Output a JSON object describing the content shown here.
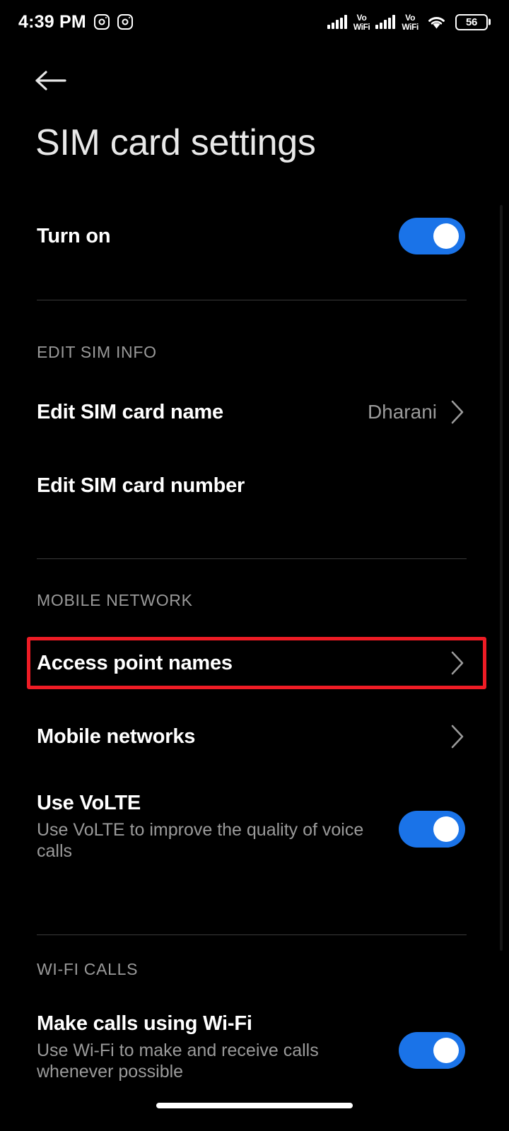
{
  "status_bar": {
    "time": "4:39 PM",
    "notification_icons": [
      "instagram-icon",
      "instagram-icon"
    ],
    "signal_1": {
      "icon": "signal-bars-icon",
      "bars": 5,
      "label_line1": "Vo",
      "label_line2": "WiFi"
    },
    "signal_2": {
      "icon": "signal-bars-icon",
      "bars": 5,
      "label_line1": "Vo",
      "label_line2": "WiFi"
    },
    "wifi_icon": "wifi-icon",
    "battery": {
      "icon": "battery-icon",
      "percent": "56"
    }
  },
  "navigation": {
    "back_icon": "back-arrow-icon",
    "gesture_bar": "home-gesture-bar"
  },
  "header": {
    "title": "SIM card settings"
  },
  "colors": {
    "background": "#000000",
    "toggle_on": "#1a73e8",
    "toggle_knob": "#ffffff",
    "primary_text": "#ffffff",
    "secondary_text": "#9a9a9a",
    "divider": "#3a3a3a",
    "highlight_border": "#ee1c25"
  },
  "main": {
    "turn_on": {
      "title": "Turn on",
      "toggle_state": "on"
    },
    "sections": [
      {
        "header": "EDIT SIM INFO",
        "rows": [
          {
            "title": "Edit SIM card name",
            "value": "Dharani",
            "chevron": true
          },
          {
            "title": "Edit SIM card number",
            "value": "",
            "chevron": false
          }
        ]
      },
      {
        "header": "MOBILE NETWORK",
        "rows": [
          {
            "title": "Access point names",
            "value": "",
            "chevron": true,
            "highlighted": true
          },
          {
            "title": "Mobile networks",
            "value": "",
            "chevron": true
          },
          {
            "title": "Use VoLTE",
            "subtitle": "Use VoLTE to improve the quality of voice calls",
            "toggle_state": "on"
          }
        ]
      },
      {
        "header": "WI-FI CALLS",
        "rows": [
          {
            "title": "Make calls using Wi-Fi",
            "subtitle": "Use Wi-Fi to make and receive calls whenever possible",
            "toggle_state": "on"
          }
        ]
      }
    ]
  }
}
